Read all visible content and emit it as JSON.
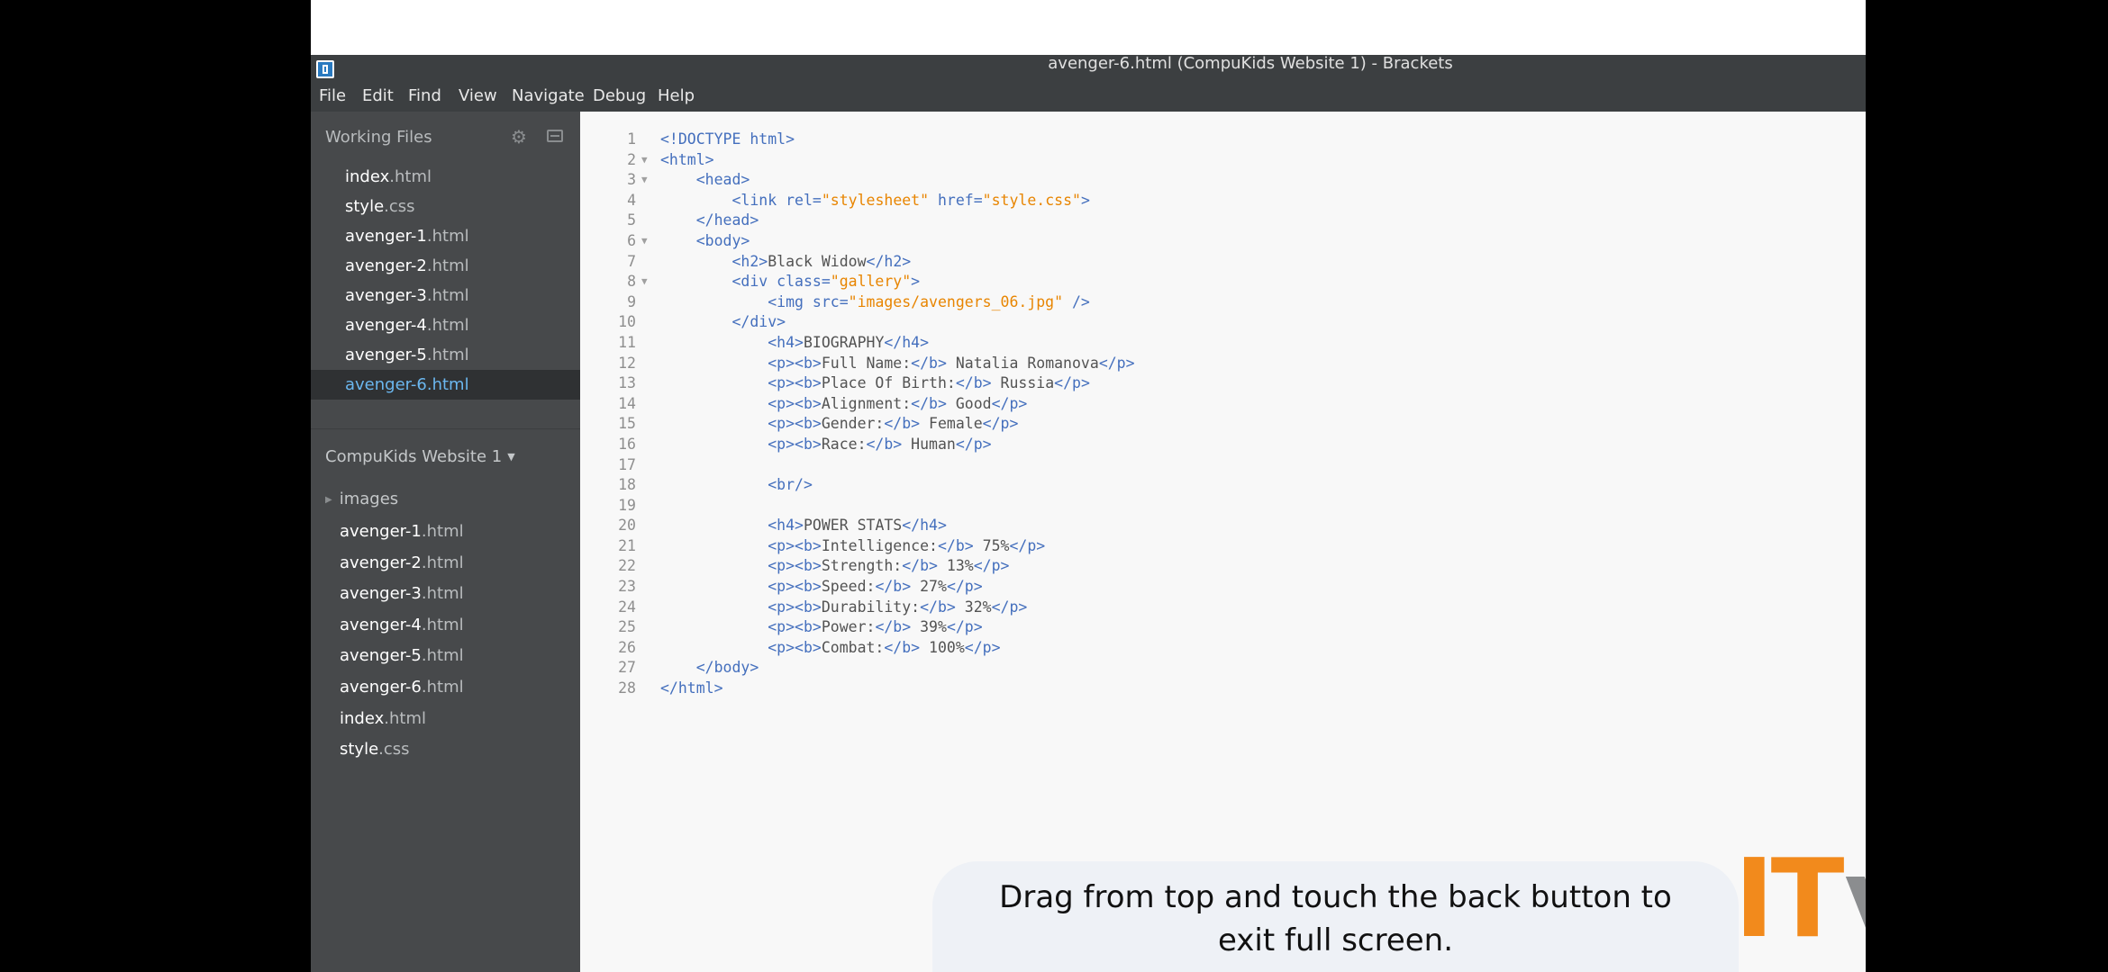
{
  "window": {
    "title": "avenger-6.html (CompuKids Website 1) - Brackets"
  },
  "menu": [
    "File",
    "Edit",
    "Find",
    "View",
    "Navigate",
    "Debug",
    "Help"
  ],
  "sidebar": {
    "working_files_label": "Working Files",
    "working_files": [
      {
        "name": "index",
        "ext": ".html",
        "active": false
      },
      {
        "name": "style",
        "ext": ".css",
        "active": false
      },
      {
        "name": "avenger-1",
        "ext": ".html",
        "active": false
      },
      {
        "name": "avenger-2",
        "ext": ".html",
        "active": false
      },
      {
        "name": "avenger-3",
        "ext": ".html",
        "active": false
      },
      {
        "name": "avenger-4",
        "ext": ".html",
        "active": false
      },
      {
        "name": "avenger-5",
        "ext": ".html",
        "active": false
      },
      {
        "name": "avenger-6.html",
        "ext": "",
        "active": true
      }
    ],
    "project_title": "CompuKids Website 1",
    "project_tree": {
      "folder": "images",
      "files": [
        {
          "name": "avenger-1",
          "ext": ".html"
        },
        {
          "name": "avenger-2",
          "ext": ".html"
        },
        {
          "name": "avenger-3",
          "ext": ".html"
        },
        {
          "name": "avenger-4",
          "ext": ".html"
        },
        {
          "name": "avenger-5",
          "ext": ".html"
        },
        {
          "name": "avenger-6",
          "ext": ".html"
        },
        {
          "name": "index",
          "ext": ".html"
        },
        {
          "name": "style",
          "ext": ".css"
        }
      ]
    }
  },
  "editor": {
    "fold_lines": [
      2,
      3,
      6,
      8
    ],
    "lines": [
      [
        [
          "t",
          "<!DOCTYPE html>"
        ]
      ],
      [
        [
          "t",
          "<html>"
        ]
      ],
      [
        [
          "x",
          "    "
        ],
        [
          "t",
          "<head>"
        ]
      ],
      [
        [
          "x",
          "        "
        ],
        [
          "t",
          "<link "
        ],
        [
          "a",
          "rel="
        ],
        [
          "s",
          "\"stylesheet\""
        ],
        [
          "x",
          " "
        ],
        [
          "a",
          "href="
        ],
        [
          "s",
          "\"style.css\""
        ],
        [
          "t",
          ">"
        ]
      ],
      [
        [
          "x",
          "    "
        ],
        [
          "t",
          "</head>"
        ]
      ],
      [
        [
          "x",
          "    "
        ],
        [
          "t",
          "<body>"
        ]
      ],
      [
        [
          "x",
          "        "
        ],
        [
          "t",
          "<h2>"
        ],
        [
          "x",
          "Black Widow"
        ],
        [
          "t",
          "</h2>"
        ]
      ],
      [
        [
          "x",
          "        "
        ],
        [
          "t",
          "<div "
        ],
        [
          "a",
          "class="
        ],
        [
          "s",
          "\"gallery\""
        ],
        [
          "t",
          ">"
        ]
      ],
      [
        [
          "x",
          "            "
        ],
        [
          "t",
          "<img "
        ],
        [
          "a",
          "src="
        ],
        [
          "s",
          "\"images/avengers_06.jpg\""
        ],
        [
          "x",
          " "
        ],
        [
          "t",
          "/>"
        ]
      ],
      [
        [
          "x",
          "        "
        ],
        [
          "t",
          "</div>"
        ]
      ],
      [
        [
          "x",
          "            "
        ],
        [
          "t",
          "<h4>"
        ],
        [
          "x",
          "BIOGRAPHY"
        ],
        [
          "t",
          "</h4>"
        ]
      ],
      [
        [
          "x",
          "            "
        ],
        [
          "t",
          "<p><b>"
        ],
        [
          "x",
          "Full Name:"
        ],
        [
          "t",
          "</b>"
        ],
        [
          "x",
          " Natalia Romanova"
        ],
        [
          "t",
          "</p>"
        ]
      ],
      [
        [
          "x",
          "            "
        ],
        [
          "t",
          "<p><b>"
        ],
        [
          "x",
          "Place Of Birth:"
        ],
        [
          "t",
          "</b>"
        ],
        [
          "x",
          " Russia"
        ],
        [
          "t",
          "</p>"
        ]
      ],
      [
        [
          "x",
          "            "
        ],
        [
          "t",
          "<p><b>"
        ],
        [
          "x",
          "Alignment:"
        ],
        [
          "t",
          "</b>"
        ],
        [
          "x",
          " Good"
        ],
        [
          "t",
          "</p>"
        ]
      ],
      [
        [
          "x",
          "            "
        ],
        [
          "t",
          "<p><b>"
        ],
        [
          "x",
          "Gender:"
        ],
        [
          "t",
          "</b>"
        ],
        [
          "x",
          " Female"
        ],
        [
          "t",
          "</p>"
        ]
      ],
      [
        [
          "x",
          "            "
        ],
        [
          "t",
          "<p><b>"
        ],
        [
          "x",
          "Race:"
        ],
        [
          "t",
          "</b>"
        ],
        [
          "x",
          " Human"
        ],
        [
          "t",
          "</p>"
        ]
      ],
      [],
      [
        [
          "x",
          "            "
        ],
        [
          "t",
          "<br/>"
        ]
      ],
      [],
      [
        [
          "x",
          "            "
        ],
        [
          "t",
          "<h4>"
        ],
        [
          "x",
          "POWER STATS"
        ],
        [
          "t",
          "</h4>"
        ]
      ],
      [
        [
          "x",
          "            "
        ],
        [
          "t",
          "<p><b>"
        ],
        [
          "x",
          "Intelligence:"
        ],
        [
          "t",
          "</b>"
        ],
        [
          "x",
          " 75%"
        ],
        [
          "t",
          "</p>"
        ]
      ],
      [
        [
          "x",
          "            "
        ],
        [
          "t",
          "<p><b>"
        ],
        [
          "x",
          "Strength:"
        ],
        [
          "t",
          "</b>"
        ],
        [
          "x",
          " 13%"
        ],
        [
          "t",
          "</p>"
        ]
      ],
      [
        [
          "x",
          "            "
        ],
        [
          "t",
          "<p><b>"
        ],
        [
          "x",
          "Speed:"
        ],
        [
          "t",
          "</b>"
        ],
        [
          "x",
          " 27%"
        ],
        [
          "t",
          "</p>"
        ]
      ],
      [
        [
          "x",
          "            "
        ],
        [
          "t",
          "<p><b>"
        ],
        [
          "x",
          "Durability:"
        ],
        [
          "t",
          "</b>"
        ],
        [
          "x",
          " 32%"
        ],
        [
          "t",
          "</p>"
        ]
      ],
      [
        [
          "x",
          "            "
        ],
        [
          "t",
          "<p><b>"
        ],
        [
          "x",
          "Power:"
        ],
        [
          "t",
          "</b>"
        ],
        [
          "x",
          " 39%"
        ],
        [
          "t",
          "</p>"
        ]
      ],
      [
        [
          "x",
          "            "
        ],
        [
          "t",
          "<p><b>"
        ],
        [
          "x",
          "Combat:"
        ],
        [
          "t",
          "</b>"
        ],
        [
          "x",
          " 100%"
        ],
        [
          "t",
          "</p>"
        ]
      ],
      [
        [
          "x",
          "    "
        ],
        [
          "t",
          "</body>"
        ]
      ],
      [
        [
          "t",
          "</html>"
        ]
      ]
    ]
  },
  "toast": {
    "line1": "Drag from top and touch the back button to",
    "line2": "exit full screen."
  },
  "watermark": {
    "part1": "IT",
    "part2": "varsity",
    "colors": {
      "it": "#f28a1c",
      "varsity": "#8b8d8f"
    }
  },
  "theme": {
    "tag": "#446fbd",
    "string": "#e88501",
    "text": "#535353",
    "active_file": "#6bb7ef"
  }
}
